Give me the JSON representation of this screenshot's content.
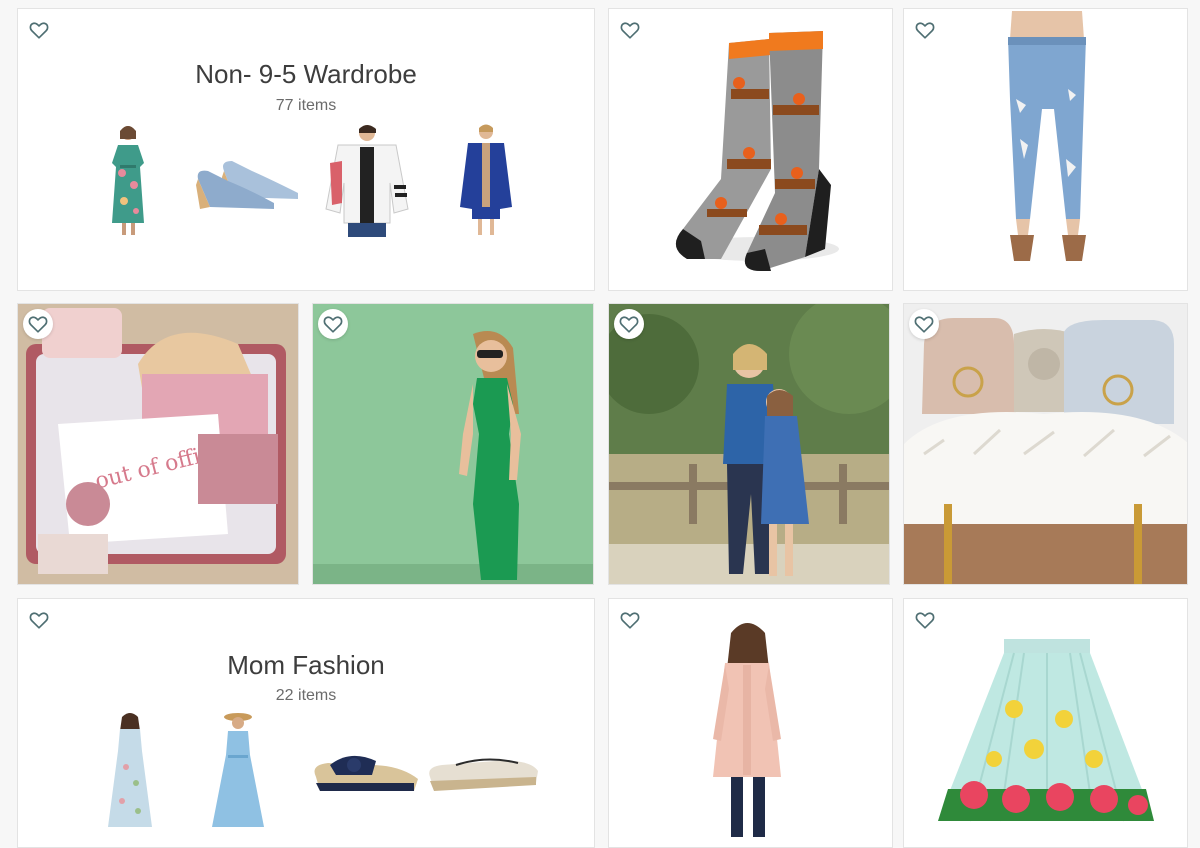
{
  "collections": [
    {
      "title": "Non- 9-5 Wardrobe",
      "count_text": "77 items",
      "thumbs": [
        "floral dress",
        "denim wedge shoes",
        "bomber jacket",
        "blue coat"
      ]
    },
    {
      "title": "Mom Fashion",
      "count_text": "22 items",
      "thumbs": [
        "floral maxi dress",
        "blue maxi dress",
        "navy bow sandals",
        "canvas espadrilles"
      ]
    }
  ],
  "products": [
    {
      "name": "red panda socks"
    },
    {
      "name": "distressed skinny jeans"
    },
    {
      "name": "pink wool coat"
    },
    {
      "name": "floral pleated skirt"
    }
  ],
  "photos": [
    {
      "name": "packed suitcase",
      "text": "out of office"
    },
    {
      "name": "woman in green dress"
    },
    {
      "name": "mother and daughter"
    },
    {
      "name": "handbags on fur chair"
    }
  ],
  "icons": {
    "favorite": "heart-outline-icon"
  },
  "colors": {
    "heart_stroke": "#4f6f73",
    "background": "#f7f7f7",
    "card_border": "#e3e3e3"
  }
}
